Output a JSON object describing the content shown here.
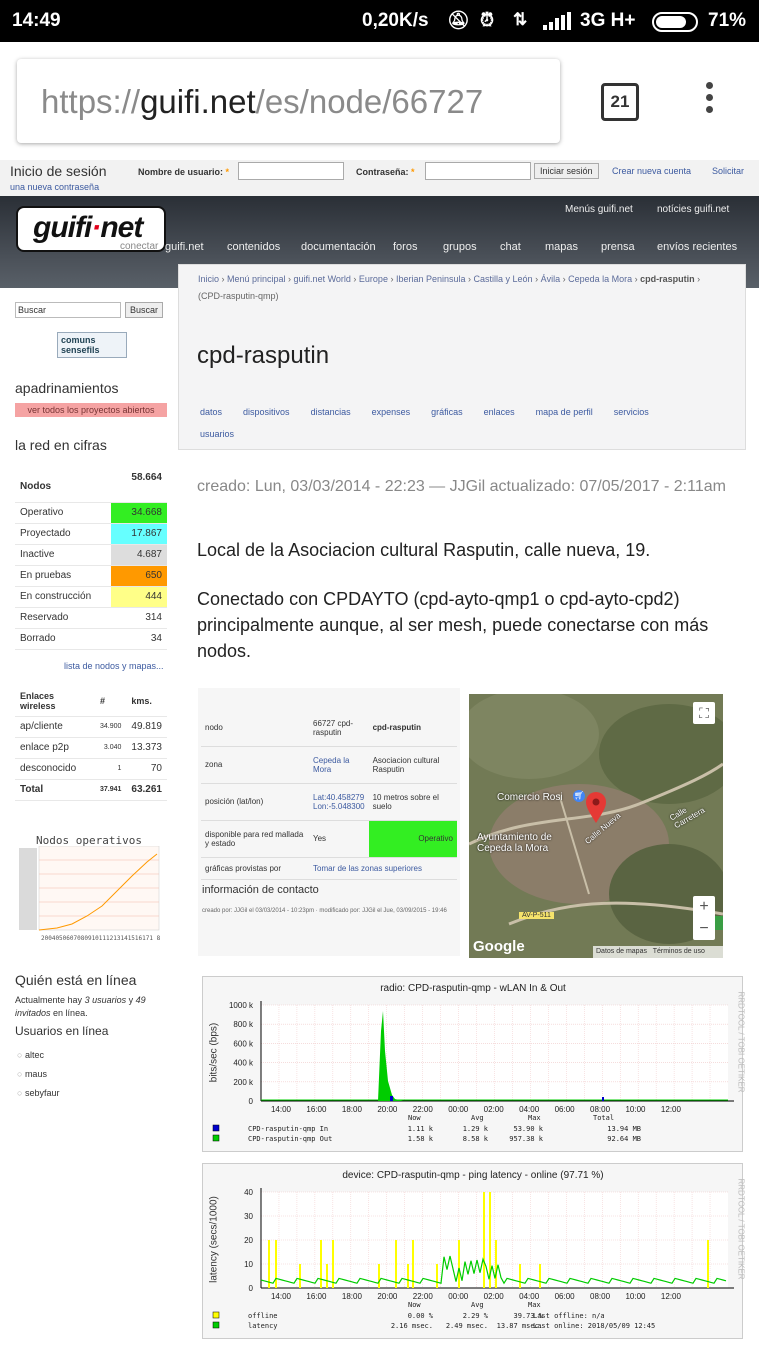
{
  "status": {
    "time": "14:49",
    "speed": "0,20K/s",
    "net": "3G H+",
    "battery": "71%"
  },
  "browser": {
    "url_pre": "https://",
    "url_domain": "guifi.net",
    "url_post": "/es/node/66727",
    "tabs": "21"
  },
  "login": {
    "title": "Inicio de sesión",
    "forgot": "una nueva contraseña",
    "user_label": "Nombre de usuario:",
    "pass_label": "Contraseña:",
    "submit": "Iniciar sesión",
    "create": "Crear nueva cuenta",
    "request": "Solicitar"
  },
  "header": {
    "logo_a": "guifi",
    "logo_dot": "·",
    "logo_b": "net",
    "tagline": "conectar",
    "menus": "Menús guifi.net",
    "news": "notícies guifi.net",
    "nav": [
      "guifi.net",
      "contenidos",
      "documentación",
      "foros",
      "grupos",
      "chat",
      "mapas",
      "prensa",
      "envíos recientes"
    ]
  },
  "sidebar": {
    "search_placeholder": "Buscar",
    "search_button": "Buscar",
    "logo_text": "comuns sensefils",
    "sponsor_title": "apadrinamientos",
    "sponsor_link": "ver todos los proyectos abiertos",
    "stats_title": "la red en cifras",
    "stats": [
      {
        "label": "Nodos",
        "value": "58.664",
        "color": "#ffffff"
      },
      {
        "label": "Operativo",
        "value": "34.668",
        "color": "#33ee22"
      },
      {
        "label": "Proyectado",
        "value": "17.867",
        "color": "#66ffff"
      },
      {
        "label": "Inactive",
        "value": "4.687",
        "color": "#dddddd"
      },
      {
        "label": "En pruebas",
        "value": "650",
        "color": "#ff9900"
      },
      {
        "label": "En construcción",
        "value": "444",
        "color": "#ffff88"
      },
      {
        "label": "Reservado",
        "value": "314",
        "color": "#ffffff"
      },
      {
        "label": "Borrado",
        "value": "34",
        "color": "#ffffff"
      }
    ],
    "node_list_link": "lista de nodos y mapas...",
    "links_head": [
      "Enlaces wireless",
      "#",
      "kms."
    ],
    "links": [
      [
        "ap/cliente",
        "34.900",
        "49.819"
      ],
      [
        "enlace p2p",
        "3.040",
        "13.373"
      ],
      [
        "desconocido",
        "1",
        "70"
      ],
      [
        "Total",
        "37.941",
        "63.261"
      ]
    ],
    "chart_title": "Nodos operativos",
    "online_title": "Quién está en línea",
    "online_pre": "Actualmente hay",
    "online_users": "3 usuarios",
    "online_mid": "y",
    "online_guests": "49 invitados",
    "online_post": "en línea.",
    "users_title": "Usuarios en línea",
    "users": [
      "altec",
      "maus",
      "sebyfaur"
    ]
  },
  "breadcrumb": {
    "items": [
      "Inicio",
      "Menú principal",
      "guifi.net World",
      "Europe",
      "Iberian Peninsula",
      "Castilla y León",
      "Ávila",
      "Cepeda la Mora"
    ],
    "current": "cpd-rasputin",
    "sub": "(CPD-rasputin-qmp)"
  },
  "page": {
    "title": "cpd-rasputin",
    "tabs": [
      "datos",
      "dispositivos",
      "distancias",
      "expenses",
      "gráficas",
      "enlaces",
      "mapa de perfil",
      "servicios",
      "usuarios"
    ],
    "meta": "creado: Lun, 03/03/2014 - 22:23 — JJGil actualizado: 07/05/2017 - 2:11am",
    "desc1": "Local de la Asociacion cultural Rasputin, calle nueva, 19.",
    "desc2": "Conectado con CPDAYTO (cpd-ayto-qmp1 o cpd-ayto-cpd2) principalmente aunque, al ser mesh, puede conectarse con más nodos."
  },
  "info": {
    "node_label": "nodo",
    "node_id": "66727 cpd-rasputin",
    "node_name": "cpd-rasputin",
    "zone_label": "zona",
    "zone_link": "Cepeda la Mora",
    "zone_text": "Asociacion cultural Rasputin",
    "pos_label": "posición (lat/lon)",
    "pos_link": "Lat:40.458279 Lon:-5.048300",
    "pos_text": "10 metros sobre el suelo",
    "mesh_label": "disponible para red mallada y estado",
    "mesh_value": "Yes",
    "mesh_status": "Operativo",
    "graphs_label": "gráficas provistas por",
    "graphs_link": "Tomar de las zonas superiores",
    "contact_title": "información de contacto",
    "created_note": "creado por: JJGil el 03/03/2014 - 10:23pm · modificado por: JJGil el Jue, 03/09/2015 - 19:46"
  },
  "map": {
    "labels": [
      "Comercio Rosi",
      "Ayuntamiento de Cepeda la Mora",
      "Calle Carretera",
      "Calle Nueva",
      "AV-P-511",
      "AV-51"
    ],
    "google": "Google",
    "credits": "Datos de mapas",
    "terms": "Términos de uso",
    "zoom_in": "+",
    "zoom_out": "−"
  },
  "graph1": {
    "title": "radio: CPD-rasputin-qmp - wLAN In & Out",
    "ylabel": "bits/sec (bps)",
    "side": "RRDTOOL / TOBI OETIKER",
    "yticks": [
      "1000 k",
      "800 k",
      "600 k",
      "400 k",
      "200 k",
      "0"
    ],
    "xticks": [
      "14:00",
      "16:00",
      "18:00",
      "20:00",
      "22:00",
      "00:00",
      "02:00",
      "04:00",
      "06:00",
      "08:00",
      "10:00",
      "12:00"
    ],
    "legend_head": [
      "Now",
      "Avg",
      "Max",
      "Total"
    ],
    "rows": [
      {
        "name": "CPD-rasputin-qmp In",
        "now": "1.11 k",
        "avg": "1.29 k",
        "max": "53.90 k",
        "total": "13.94 MB",
        "color": "#0000cc"
      },
      {
        "name": "CPD-rasputin-qmp Out",
        "now": "1.58 k",
        "avg": "8.58 k",
        "max": "957.38 k",
        "total": "92.64 MB",
        "color": "#00cc00"
      }
    ]
  },
  "graph2": {
    "title": "device: CPD-rasputin-qmp -  ping latency - online (97.71 %)",
    "ylabel": "latency (secs/1000)",
    "side": "RRDTOOL / TOBI OETIKER",
    "yticks": [
      "40",
      "30",
      "20",
      "10",
      "0"
    ],
    "xticks": [
      "14:00",
      "16:00",
      "18:00",
      "20:00",
      "22:00",
      "00:00",
      "02:00",
      "04:00",
      "06:00",
      "08:00",
      "10:00",
      "12:00"
    ],
    "legend_head": [
      "Now",
      "Avg",
      "Max"
    ],
    "rows": [
      {
        "name": "offline",
        "now": "0.00 %",
        "avg": "2.29 %",
        "max": "39.73 %",
        "extra": "Last offline: n/a",
        "color": "#ffff00"
      },
      {
        "name": "latency",
        "now": "2.16 msec.",
        "avg": "2.49 msec.",
        "max": "13.87 msec.",
        "extra": "Last online: 2018/05/09 12:45",
        "color": "#00cc00"
      }
    ]
  }
}
